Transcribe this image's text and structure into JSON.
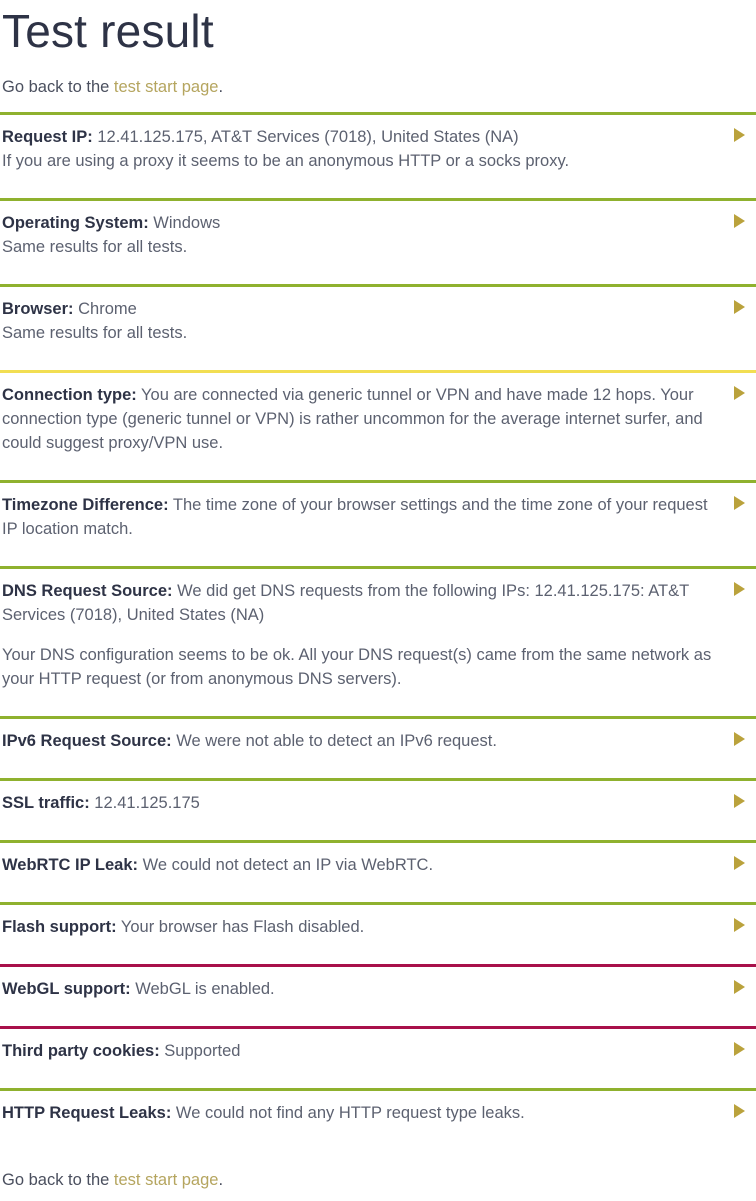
{
  "page": {
    "title": "Test result"
  },
  "goback_top": {
    "prefix": "Go back to the ",
    "link": "test start page",
    "suffix": "."
  },
  "goback_bottom": {
    "prefix": "Go back to the ",
    "link": "test start page",
    "suffix": "."
  },
  "colors": {
    "status_ok": "#8fb12e",
    "status_warn": "#f2de52",
    "status_danger": "#a8104a",
    "link": "#b5a55f",
    "label": "#2e3346",
    "body": "#5c6170",
    "arrow": "#baa23c"
  },
  "icons": {
    "expand": "expand-triangle-icon"
  },
  "results": [
    {
      "label": "Request IP:",
      "value": " 12.41.125.175, AT&T Services (7018), United States (NA)",
      "note": "If you are using a proxy it seems to be an anonymous HTTP or a socks proxy.",
      "status": "ok"
    },
    {
      "label": "Operating System:",
      "value": " Windows",
      "note": "Same results for all tests.",
      "status": "ok"
    },
    {
      "label": "Browser:",
      "value": " Chrome",
      "note": "Same results for all tests.",
      "status": "ok"
    },
    {
      "label": "Connection type:",
      "value": " You are connected via generic tunnel or VPN and have made 12 hops. Your connection type (generic tunnel or VPN) is rather uncommon for the average internet surfer, and could suggest proxy/VPN use.",
      "note": "",
      "status": "warn"
    },
    {
      "label": "Timezone Difference:",
      "value": " The time zone of your browser settings and the time zone of your request IP location match.",
      "note": "",
      "status": "ok"
    },
    {
      "label": "DNS Request Source:",
      "value": " We did get DNS requests from the following IPs: 12.41.125.175: AT&T Services (7018), United States (NA)",
      "note": "Your DNS configuration seems to be ok. All your DNS request(s) came from the same network as your HTTP request (or from anonymous DNS servers).",
      "status": "ok"
    },
    {
      "label": "IPv6 Request Source:",
      "value": " We were not able to detect an IPv6 request.",
      "note": "",
      "status": "ok"
    },
    {
      "label": "SSL traffic:",
      "value": " 12.41.125.175",
      "note": "",
      "status": "ok"
    },
    {
      "label": "WebRTC IP Leak:",
      "value": " We could not detect an IP via WebRTC.",
      "note": "",
      "status": "ok"
    },
    {
      "label": "Flash support:",
      "value": " Your browser has Flash disabled.",
      "note": "",
      "status": "ok"
    },
    {
      "label": "WebGL support:",
      "value": " WebGL is enabled.",
      "note": "",
      "status": "danger"
    },
    {
      "label": "Third party cookies:",
      "value": " Supported",
      "note": "",
      "status": "danger"
    },
    {
      "label": "HTTP Request Leaks:",
      "value": " We could not find any HTTP request type leaks.",
      "note": "",
      "status": "ok"
    }
  ]
}
